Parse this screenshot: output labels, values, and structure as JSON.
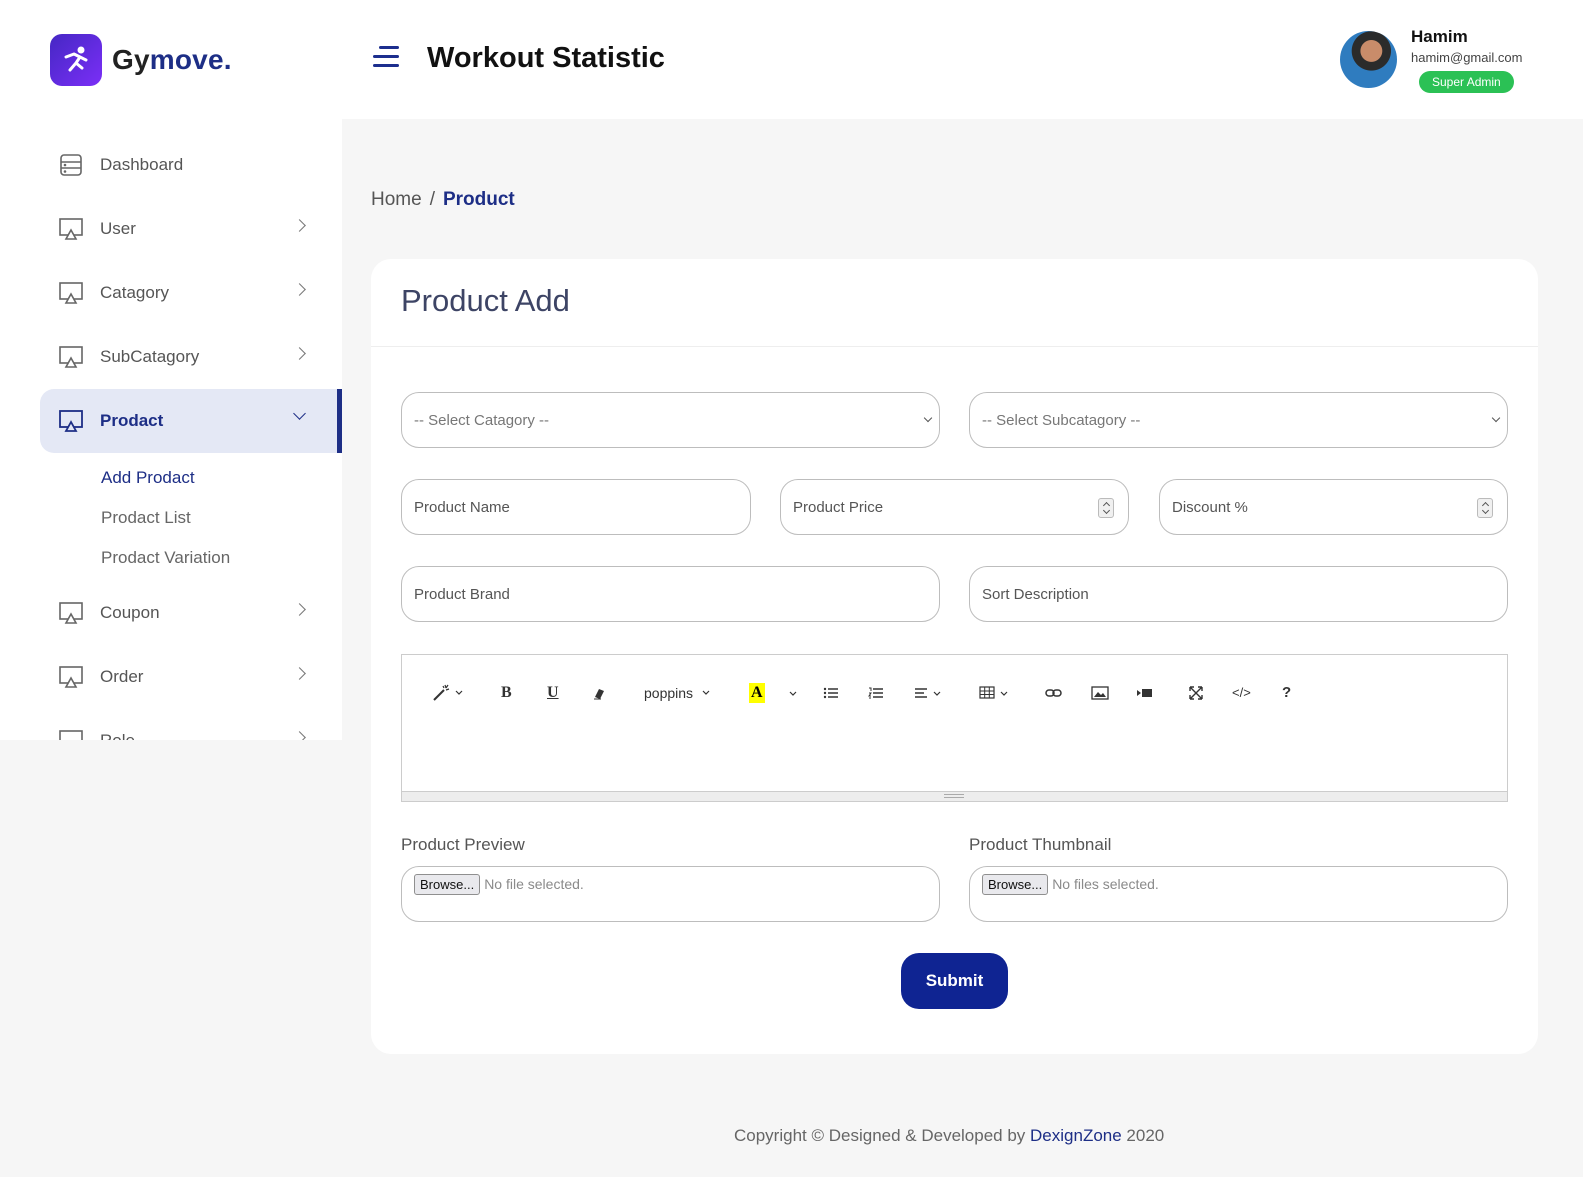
{
  "brand": {
    "name_part1": "Gy",
    "name_part2": "move."
  },
  "header": {
    "title": "Workout Statistic"
  },
  "user": {
    "name": "Hamim",
    "email": "hamim@gmail.com",
    "role": "Super Admin"
  },
  "sidebar": {
    "items": [
      {
        "label": "Dashboard"
      },
      {
        "label": "User"
      },
      {
        "label": "Catagory"
      },
      {
        "label": "SubCatagory"
      },
      {
        "label": "Prodact"
      },
      {
        "label": "Coupon"
      },
      {
        "label": "Order"
      },
      {
        "label": "Role"
      }
    ],
    "subitems": [
      {
        "label": "Add Prodact"
      },
      {
        "label": "Prodact List"
      },
      {
        "label": "Prodact Variation"
      }
    ]
  },
  "breadcrumb": {
    "home": "Home",
    "sep": "/",
    "current": "Product"
  },
  "card": {
    "title": "Product Add"
  },
  "form": {
    "category_placeholder": "-- Select Catagory --",
    "subcategory_placeholder": "-- Select Subcatagory --",
    "product_name": "Product Name",
    "product_price": "Product Price",
    "discount": "Discount %",
    "product_brand": "Product Brand",
    "sort_description": "Sort Description",
    "preview_label": "Product Preview",
    "thumbnail_label": "Product Thumbnail",
    "browse_label": "Browse...",
    "preview_status": "No file selected.",
    "thumbnail_status": "No files selected.",
    "submit_label": "Submit"
  },
  "editor": {
    "font_name": "poppins",
    "code_label": "</>",
    "help_label": "?",
    "bold_label": "B",
    "underline_label": "U",
    "color_label": "A"
  },
  "footer": {
    "prefix": "Copyright © Designed & Developed by ",
    "brand": "DexignZone",
    "year": " 2020"
  },
  "colors": {
    "accent": "#1d2e86",
    "submit": "#0f2492",
    "badge": "#2bc155"
  }
}
